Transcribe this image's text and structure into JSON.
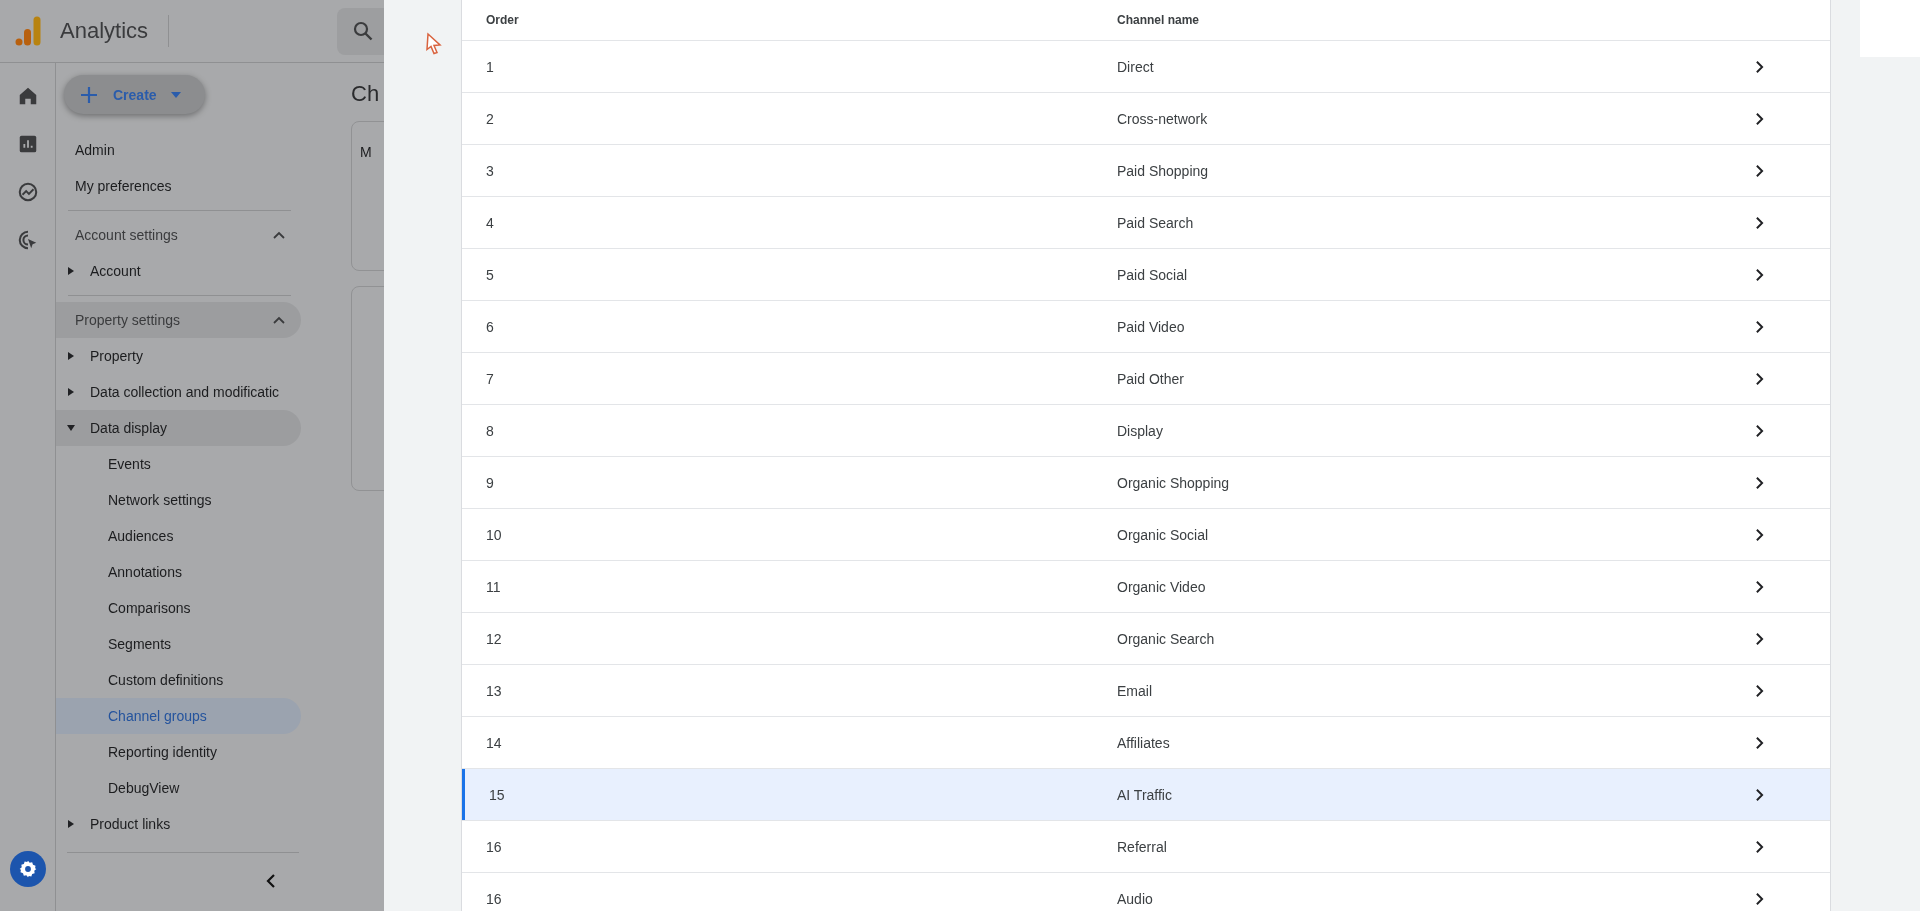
{
  "app": {
    "title": "Analytics",
    "page_title": "Ch",
    "card_text": "M"
  },
  "sidebar": {
    "create_button": "Create",
    "links": [
      {
        "label": "Admin"
      },
      {
        "label": "My preferences"
      }
    ],
    "sections": [
      {
        "title": "Account settings",
        "expanded": true,
        "highlighted": false,
        "items": [
          {
            "label": "Account",
            "expanded": false,
            "highlighted": false
          }
        ]
      },
      {
        "title": "Property settings",
        "expanded": true,
        "highlighted": true,
        "items": [
          {
            "label": "Property",
            "expanded": false,
            "highlighted": false
          },
          {
            "label": "Data collection and modificatic",
            "expanded": false,
            "highlighted": false
          },
          {
            "label": "Data display",
            "expanded": true,
            "highlighted": true,
            "children": [
              {
                "label": "Events",
                "selected": false
              },
              {
                "label": "Network settings",
                "selected": false
              },
              {
                "label": "Audiences",
                "selected": false
              },
              {
                "label": "Annotations",
                "selected": false
              },
              {
                "label": "Comparisons",
                "selected": false
              },
              {
                "label": "Segments",
                "selected": false
              },
              {
                "label": "Custom definitions",
                "selected": false
              },
              {
                "label": "Channel groups",
                "selected": true
              },
              {
                "label": "Reporting identity",
                "selected": false
              },
              {
                "label": "DebugView",
                "selected": false
              }
            ]
          },
          {
            "label": "Product links",
            "expanded": false,
            "highlighted": false
          }
        ]
      }
    ]
  },
  "panel": {
    "columns": [
      "Order",
      "Channel name"
    ],
    "rows": [
      {
        "order": "1",
        "name": "Direct",
        "selected": false
      },
      {
        "order": "2",
        "name": "Cross-network",
        "selected": false
      },
      {
        "order": "3",
        "name": "Paid Shopping",
        "selected": false
      },
      {
        "order": "4",
        "name": "Paid Search",
        "selected": false
      },
      {
        "order": "5",
        "name": "Paid Social",
        "selected": false
      },
      {
        "order": "6",
        "name": "Paid Video",
        "selected": false
      },
      {
        "order": "7",
        "name": "Paid Other",
        "selected": false
      },
      {
        "order": "8",
        "name": "Display",
        "selected": false
      },
      {
        "order": "9",
        "name": "Organic Shopping",
        "selected": false
      },
      {
        "order": "10",
        "name": "Organic Social",
        "selected": false
      },
      {
        "order": "11",
        "name": "Organic Video",
        "selected": false
      },
      {
        "order": "12",
        "name": "Organic Search",
        "selected": false
      },
      {
        "order": "13",
        "name": "Email",
        "selected": false
      },
      {
        "order": "14",
        "name": "Affiliates",
        "selected": false
      },
      {
        "order": "15",
        "name": "AI Traffic",
        "selected": true
      },
      {
        "order": "16",
        "name": "Referral",
        "selected": false
      },
      {
        "order": "16",
        "name": "Audio",
        "selected": false
      }
    ]
  }
}
